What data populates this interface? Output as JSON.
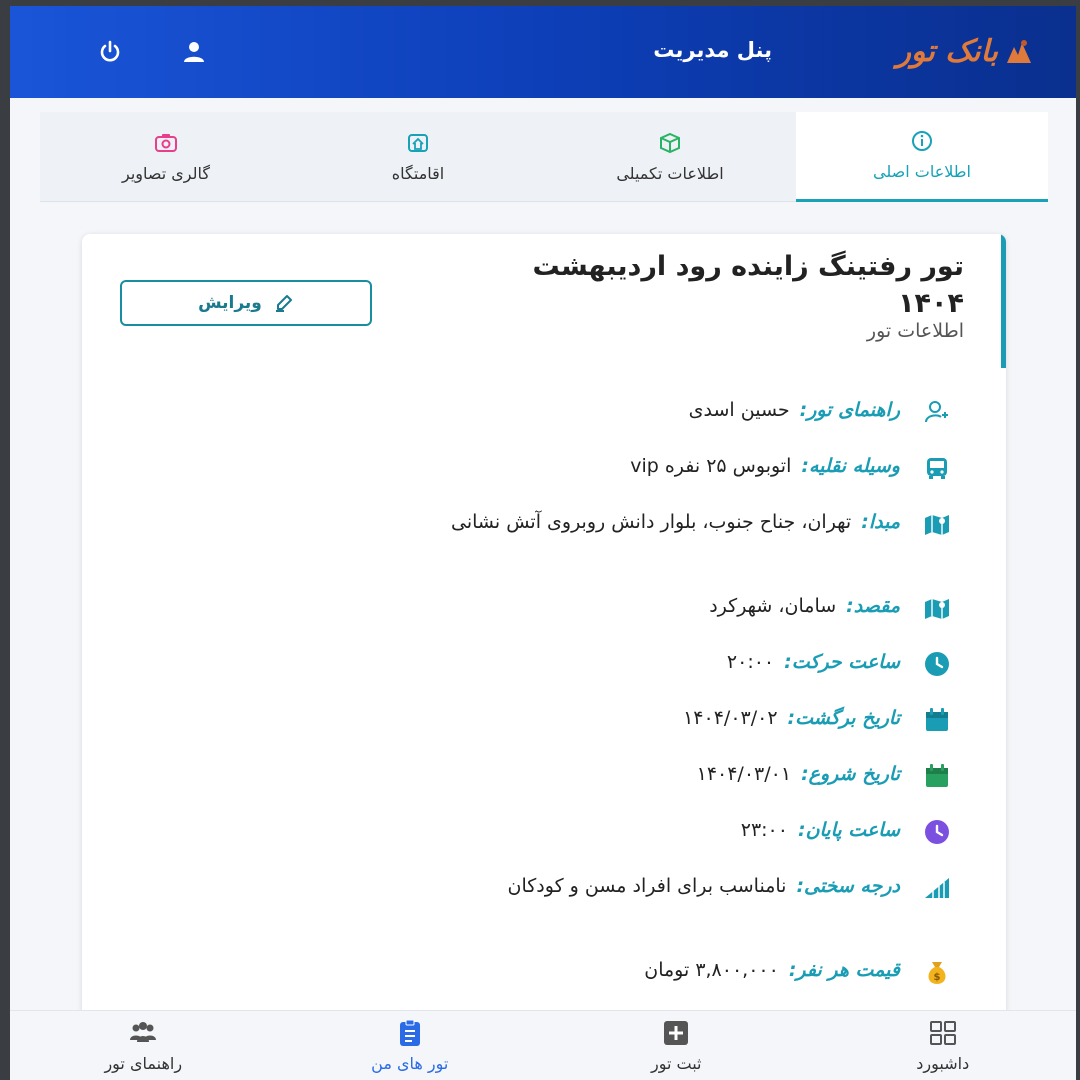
{
  "header": {
    "logo_text": "بانک تور",
    "title": "پنل مدیریت"
  },
  "tabs": [
    {
      "label": "اطلاعات اصلی",
      "active": true,
      "color": "#17a2b8"
    },
    {
      "label": "اطلاعات تکمیلی",
      "active": false,
      "color": "#28b463"
    },
    {
      "label": "اقامتگاه",
      "active": false,
      "color": "#17a2b8"
    },
    {
      "label": "گالری تصاویر",
      "active": false,
      "color": "#e83e8c"
    }
  ],
  "card": {
    "title": "تور رفتینگ زاینده رود اردیبهشت ۱۴۰۴",
    "subtitle": "اطلاعات تور",
    "edit_label": "ویرایش",
    "rows": [
      {
        "label": "راهنمای تور:",
        "value": "حسین اسدی",
        "icon": "guide-icon"
      },
      {
        "label": "وسیله نقلیه:",
        "value": "اتوبوس ۲۵ نفره vip",
        "icon": "bus-icon"
      },
      {
        "label": "مبدا:",
        "value": "تهران، جناح جنوب، بلوار دانش روبروی آتش نشانی",
        "icon": "map-icon"
      },
      {
        "label": "مقصد:",
        "value": "سامان، شهرکرد",
        "icon": "map-icon"
      },
      {
        "label": "ساعت حرکت:",
        "value": "۲۰:۰۰",
        "icon": "clock-icon"
      },
      {
        "label": "تاریخ برگشت:",
        "value": "۱۴۰۴/۰۳/۰۲",
        "icon": "calendar-icon"
      },
      {
        "label": "تاریخ شروع:",
        "value": "۱۴۰۴/۰۳/۰۱",
        "icon": "calendar-icon"
      },
      {
        "label": "ساعت پایان:",
        "value": "۲۳:۰۰",
        "icon": "clock-icon"
      },
      {
        "label": "درجه سختی:",
        "value": "نامناسب برای افراد مسن و کودکان",
        "icon": "difficulty-icon"
      },
      {
        "label": "قیمت هر نفر:",
        "value": "۳,۸۰۰,۰۰۰ تومان",
        "icon": "money-bag-icon"
      }
    ]
  },
  "bottom_nav": [
    {
      "label": "داشبورد",
      "active": false
    },
    {
      "label": "ثبت تور",
      "active": false
    },
    {
      "label": "تور های من",
      "active": true
    },
    {
      "label": "راهنمای تور",
      "active": false
    }
  ],
  "colors": {
    "header_start": "#1a55d8",
    "header_end": "#0a2f8e",
    "accent": "#1a9db4",
    "active_nav": "#2b6be6"
  }
}
